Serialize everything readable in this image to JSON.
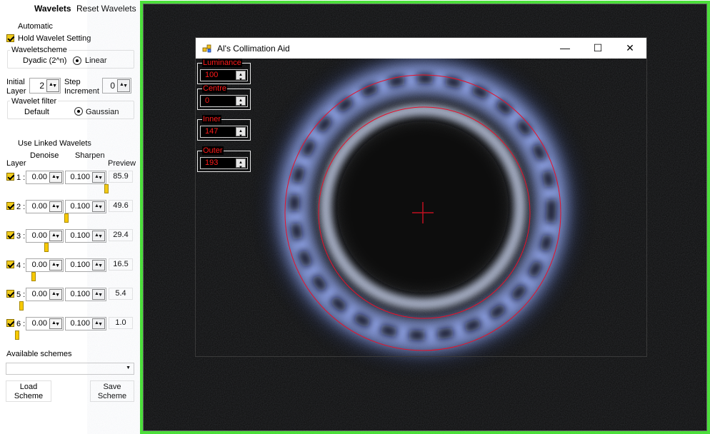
{
  "header": {
    "wavelets_tab": "Wavelets",
    "reset_button": "Reset Wavelets"
  },
  "automatic_label": "Automatic",
  "hold_setting_label": "Hold Wavelet Setting",
  "waveletscheme": {
    "title": "Waveletscheme",
    "option_dyadic": "Dyadic (2^n)",
    "option_linear": "Linear",
    "selected": "Linear"
  },
  "initial_layer": {
    "label_line1": "Initial",
    "label_line2": "Layer",
    "value": "2"
  },
  "step_increment": {
    "label_line1": "Step",
    "label_line2": "Increment",
    "value": "0"
  },
  "wavelet_filter": {
    "title": "Wavelet filter",
    "option_default": "Default",
    "option_gaussian": "Gaussian",
    "selected": "Gaussian"
  },
  "use_linked_label": "Use Linked Wavelets",
  "columns": {
    "layer": "Layer",
    "denoise": "Denoise",
    "sharpen": "Sharpen",
    "preview": "Preview"
  },
  "layers": [
    {
      "label": "1 :",
      "denoise": "0.00",
      "sharpen": "0.100",
      "preview": "85.9",
      "slider": 0.9
    },
    {
      "label": "2 :",
      "denoise": "0.00",
      "sharpen": "0.100",
      "preview": "49.6",
      "slider": 0.5
    },
    {
      "label": "3 :",
      "denoise": "0.00",
      "sharpen": "0.100",
      "preview": "29.4",
      "slider": 0.3
    },
    {
      "label": "4 :",
      "denoise": "0.00",
      "sharpen": "0.100",
      "preview": "16.5",
      "slider": 0.17
    },
    {
      "label": "5 :",
      "denoise": "0.00",
      "sharpen": "0.100",
      "preview": "5.4",
      "slider": 0.05
    },
    {
      "label": "6 :",
      "denoise": "0.00",
      "sharpen": "0.100",
      "preview": "1.0",
      "slider": 0.01
    }
  ],
  "available_schemes_label": "Available schemes",
  "load_scheme": {
    "line1": "Load",
    "line2": "Scheme"
  },
  "save_scheme": {
    "line1": "Save",
    "line2": "Scheme"
  },
  "collimation": {
    "title": "Al's Collimation Aid",
    "minimize": "—",
    "maximize": "☐",
    "close": "✕",
    "controls": [
      {
        "label": "Luminance",
        "value": "100"
      },
      {
        "label": "Centre",
        "value": "0"
      },
      {
        "label": "Inner",
        "value": "147"
      },
      {
        "label": "Outer",
        "value": "193"
      }
    ]
  },
  "colors": {
    "accent_green": "#3fe02a",
    "overlay_red": "#ff1a1a",
    "checkbox_yellow": "#f2cc1a"
  }
}
